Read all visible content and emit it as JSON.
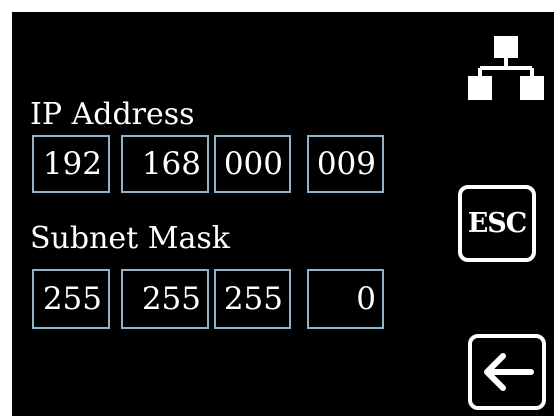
{
  "ip_section": {
    "label": "IP Address",
    "octets": [
      "192",
      "168",
      "000",
      "009"
    ]
  },
  "subnet_section": {
    "label": "Subnet Mask",
    "octets": [
      "255",
      "255",
      "255",
      "0"
    ]
  },
  "buttons": {
    "esc_label": "ESC",
    "back_icon": "arrow-left-icon",
    "network_icon": "network-icon"
  },
  "colors": {
    "background": "#000000",
    "field_border": "#8fb3c8",
    "text": "#ffffff"
  }
}
